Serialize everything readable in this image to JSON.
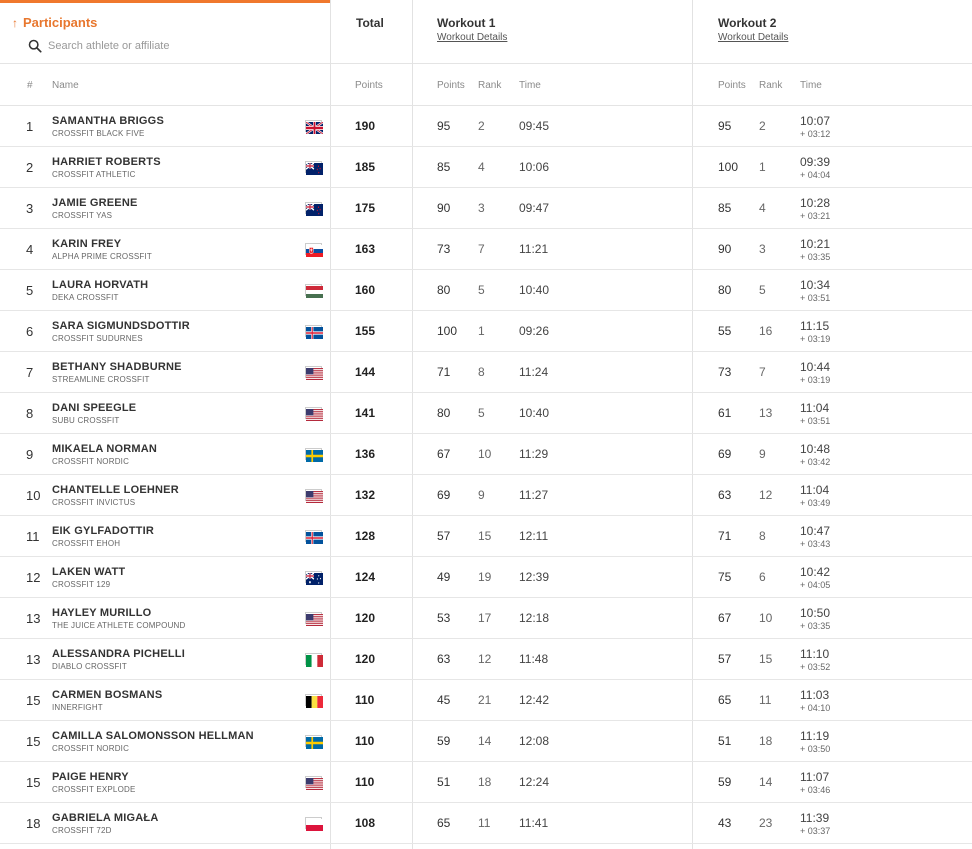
{
  "header": {
    "participants_label": "Participants",
    "search_placeholder": "Search athlete or affiliate",
    "total_label": "Total",
    "workout1_label": "Workout 1",
    "workout1_details": "Workout Details",
    "workout2_label": "Workout 2",
    "workout2_details": "Workout Details"
  },
  "columns": {
    "rank": "#",
    "name": "Name",
    "points": "Points",
    "w1_points": "Points",
    "w1_rank": "Rank",
    "w1_time": "Time",
    "w2_points": "Points",
    "w2_rank": "Rank",
    "w2_time": "Time"
  },
  "colors": {
    "accent": "#e8772e"
  },
  "rows": [
    {
      "rank": "1",
      "name": "SAMANTHA BRIGGS",
      "affiliate": "CROSSFIT BLACK FIVE",
      "flag": "gb",
      "total": "190",
      "w1_points": "95",
      "w1_rank": "2",
      "w1_time": "09:45",
      "w2_points": "95",
      "w2_rank": "2",
      "w2_time": "10:07",
      "w2_delta": "+ 03:12"
    },
    {
      "rank": "2",
      "name": "HARRIET ROBERTS",
      "affiliate": "CROSSFIT ATHLETIC",
      "flag": "nz",
      "total": "185",
      "w1_points": "85",
      "w1_rank": "4",
      "w1_time": "10:06",
      "w2_points": "100",
      "w2_rank": "1",
      "w2_time": "09:39",
      "w2_delta": "+ 04:04"
    },
    {
      "rank": "3",
      "name": "JAMIE GREENE",
      "affiliate": "CROSSFIT YAS",
      "flag": "nz",
      "total": "175",
      "w1_points": "90",
      "w1_rank": "3",
      "w1_time": "09:47",
      "w2_points": "85",
      "w2_rank": "4",
      "w2_time": "10:28",
      "w2_delta": "+ 03:21"
    },
    {
      "rank": "4",
      "name": "KARIN FREY",
      "affiliate": "ALPHA PRIME CROSSFIT",
      "flag": "sk",
      "total": "163",
      "w1_points": "73",
      "w1_rank": "7",
      "w1_time": "11:21",
      "w2_points": "90",
      "w2_rank": "3",
      "w2_time": "10:21",
      "w2_delta": "+ 03:35"
    },
    {
      "rank": "5",
      "name": "LAURA HORVATH",
      "affiliate": "DEKA CROSSFIT",
      "flag": "hu",
      "total": "160",
      "w1_points": "80",
      "w1_rank": "5",
      "w1_time": "10:40",
      "w2_points": "80",
      "w2_rank": "5",
      "w2_time": "10:34",
      "w2_delta": "+ 03:51"
    },
    {
      "rank": "6",
      "name": "SARA SIGMUNDSDOTTIR",
      "affiliate": "CROSSFIT SUDURNES",
      "flag": "is",
      "total": "155",
      "w1_points": "100",
      "w1_rank": "1",
      "w1_time": "09:26",
      "w2_points": "55",
      "w2_rank": "16",
      "w2_time": "11:15",
      "w2_delta": "+ 03:19"
    },
    {
      "rank": "7",
      "name": "BETHANY SHADBURNE",
      "affiliate": "STREAMLINE CROSSFIT",
      "flag": "us",
      "total": "144",
      "w1_points": "71",
      "w1_rank": "8",
      "w1_time": "11:24",
      "w2_points": "73",
      "w2_rank": "7",
      "w2_time": "10:44",
      "w2_delta": "+ 03:19"
    },
    {
      "rank": "8",
      "name": "DANI SPEEGLE",
      "affiliate": "SUBU CROSSFIT",
      "flag": "us",
      "total": "141",
      "w1_points": "80",
      "w1_rank": "5",
      "w1_time": "10:40",
      "w2_points": "61",
      "w2_rank": "13",
      "w2_time": "11:04",
      "w2_delta": "+ 03:51"
    },
    {
      "rank": "9",
      "name": "MIKAELA NORMAN",
      "affiliate": "CROSSFIT NORDIC",
      "flag": "se",
      "total": "136",
      "w1_points": "67",
      "w1_rank": "10",
      "w1_time": "11:29",
      "w2_points": "69",
      "w2_rank": "9",
      "w2_time": "10:48",
      "w2_delta": "+ 03:42"
    },
    {
      "rank": "10",
      "name": "CHANTELLE LOEHNER",
      "affiliate": "CROSSFIT INVICTUS",
      "flag": "us",
      "total": "132",
      "w1_points": "69",
      "w1_rank": "9",
      "w1_time": "11:27",
      "w2_points": "63",
      "w2_rank": "12",
      "w2_time": "11:04",
      "w2_delta": "+ 03:49"
    },
    {
      "rank": "11",
      "name": "EIK GYLFADOTTIR",
      "affiliate": "CROSSFIT EHOH",
      "flag": "is",
      "total": "128",
      "w1_points": "57",
      "w1_rank": "15",
      "w1_time": "12:11",
      "w2_points": "71",
      "w2_rank": "8",
      "w2_time": "10:47",
      "w2_delta": "+ 03:43"
    },
    {
      "rank": "12",
      "name": "LAKEN WATT",
      "affiliate": "CROSSFIT 129",
      "flag": "au",
      "total": "124",
      "w1_points": "49",
      "w1_rank": "19",
      "w1_time": "12:39",
      "w2_points": "75",
      "w2_rank": "6",
      "w2_time": "10:42",
      "w2_delta": "+ 04:05"
    },
    {
      "rank": "13",
      "name": "HAYLEY MURILLO",
      "affiliate": "THE JUICE ATHLETE COMPOUND",
      "flag": "us",
      "total": "120",
      "w1_points": "53",
      "w1_rank": "17",
      "w1_time": "12:18",
      "w2_points": "67",
      "w2_rank": "10",
      "w2_time": "10:50",
      "w2_delta": "+ 03:35"
    },
    {
      "rank": "13",
      "name": "ALESSANDRA PICHELLI",
      "affiliate": "DIABLO CROSSFIT",
      "flag": "it",
      "total": "120",
      "w1_points": "63",
      "w1_rank": "12",
      "w1_time": "11:48",
      "w2_points": "57",
      "w2_rank": "15",
      "w2_time": "11:10",
      "w2_delta": "+ 03:52"
    },
    {
      "rank": "15",
      "name": "CARMEN BOSMANS",
      "affiliate": "INNERFIGHT",
      "flag": "be",
      "total": "110",
      "w1_points": "45",
      "w1_rank": "21",
      "w1_time": "12:42",
      "w2_points": "65",
      "w2_rank": "11",
      "w2_time": "11:03",
      "w2_delta": "+ 04:10"
    },
    {
      "rank": "15",
      "name": "CAMILLA SALOMONSSON HELLMAN",
      "affiliate": "CROSSFIT NORDIC",
      "flag": "se",
      "total": "110",
      "w1_points": "59",
      "w1_rank": "14",
      "w1_time": "12:08",
      "w2_points": "51",
      "w2_rank": "18",
      "w2_time": "11:19",
      "w2_delta": "+ 03:50"
    },
    {
      "rank": "15",
      "name": "PAIGE HENRY",
      "affiliate": "CROSSFIT EXPLODE",
      "flag": "us",
      "total": "110",
      "w1_points": "51",
      "w1_rank": "18",
      "w1_time": "12:24",
      "w2_points": "59",
      "w2_rank": "14",
      "w2_time": "11:07",
      "w2_delta": "+ 03:46"
    },
    {
      "rank": "18",
      "name": "GABRIELA MIGAŁA",
      "affiliate": "CROSSFIT 72D",
      "flag": "pl",
      "total": "108",
      "w1_points": "65",
      "w1_rank": "11",
      "w1_time": "11:41",
      "w2_points": "43",
      "w2_rank": "23",
      "w2_time": "11:39",
      "w2_delta": "+ 03:37"
    }
  ]
}
